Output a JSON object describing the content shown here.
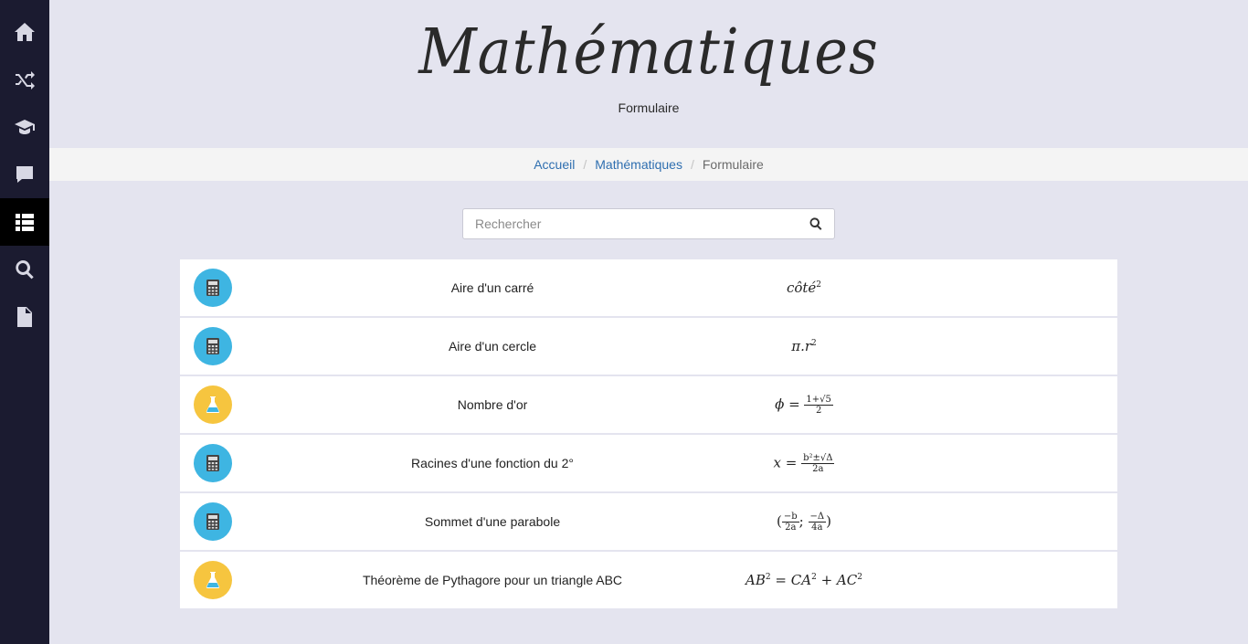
{
  "sidebar": {
    "items": [
      {
        "icon": "home-icon",
        "active": false
      },
      {
        "icon": "shuffle-icon",
        "active": false
      },
      {
        "icon": "graduation-cap-icon",
        "active": false
      },
      {
        "icon": "comment-icon",
        "active": false
      },
      {
        "icon": "list-icon",
        "active": true
      },
      {
        "icon": "search-icon",
        "active": false
      },
      {
        "icon": "file-icon",
        "active": false
      }
    ]
  },
  "header": {
    "brand": "Mathématiques",
    "subtitle": "Formulaire"
  },
  "breadcrumb": {
    "home": "Accueil",
    "section": "Mathématiques",
    "current": "Formulaire",
    "separator": "/"
  },
  "search": {
    "placeholder": "Rechercher"
  },
  "formulas": [
    {
      "icon": "calculator-icon",
      "color": "#3eb5e2",
      "name": "Aire d'un carré",
      "formula": "côté²"
    },
    {
      "icon": "calculator-icon",
      "color": "#3eb5e2",
      "name": "Aire d'un cercle",
      "formula": "π.r²"
    },
    {
      "icon": "flask-icon",
      "color": "#f6c53f",
      "name": "Nombre d'or",
      "formula": "ϕ = (1+√5)/2"
    },
    {
      "icon": "calculator-icon",
      "color": "#3eb5e2",
      "name": "Racines d'une fonction du 2°",
      "formula": "x = (b²±√Δ)/2a"
    },
    {
      "icon": "calculator-icon",
      "color": "#3eb5e2",
      "name": "Sommet d'une parabole",
      "formula": "(−b/2a; −Δ/4a)"
    },
    {
      "icon": "flask-icon",
      "color": "#f6c53f",
      "name": "Théorème de Pythagore pour un triangle ABC",
      "formula": "AB² = CA² + AC²"
    }
  ],
  "formula_parts": {
    "f0": {
      "base": "côté",
      "exp": "2"
    },
    "f1": {
      "base": "π.r",
      "exp": "2"
    },
    "f2": {
      "lhs": "ϕ =",
      "num": "1+√5",
      "den": "2"
    },
    "f3": {
      "lhs": "x =",
      "num": "b²±√Δ",
      "den": "2a"
    },
    "f4": {
      "open": "(",
      "num1": "−b",
      "den1": "2a",
      "sep": ";",
      "num2": "−Δ",
      "den2": "4a",
      "close": ")"
    },
    "f5": {
      "a": "AB",
      "eq": " = CA",
      "plus": " + AC",
      "exp": "2"
    }
  }
}
